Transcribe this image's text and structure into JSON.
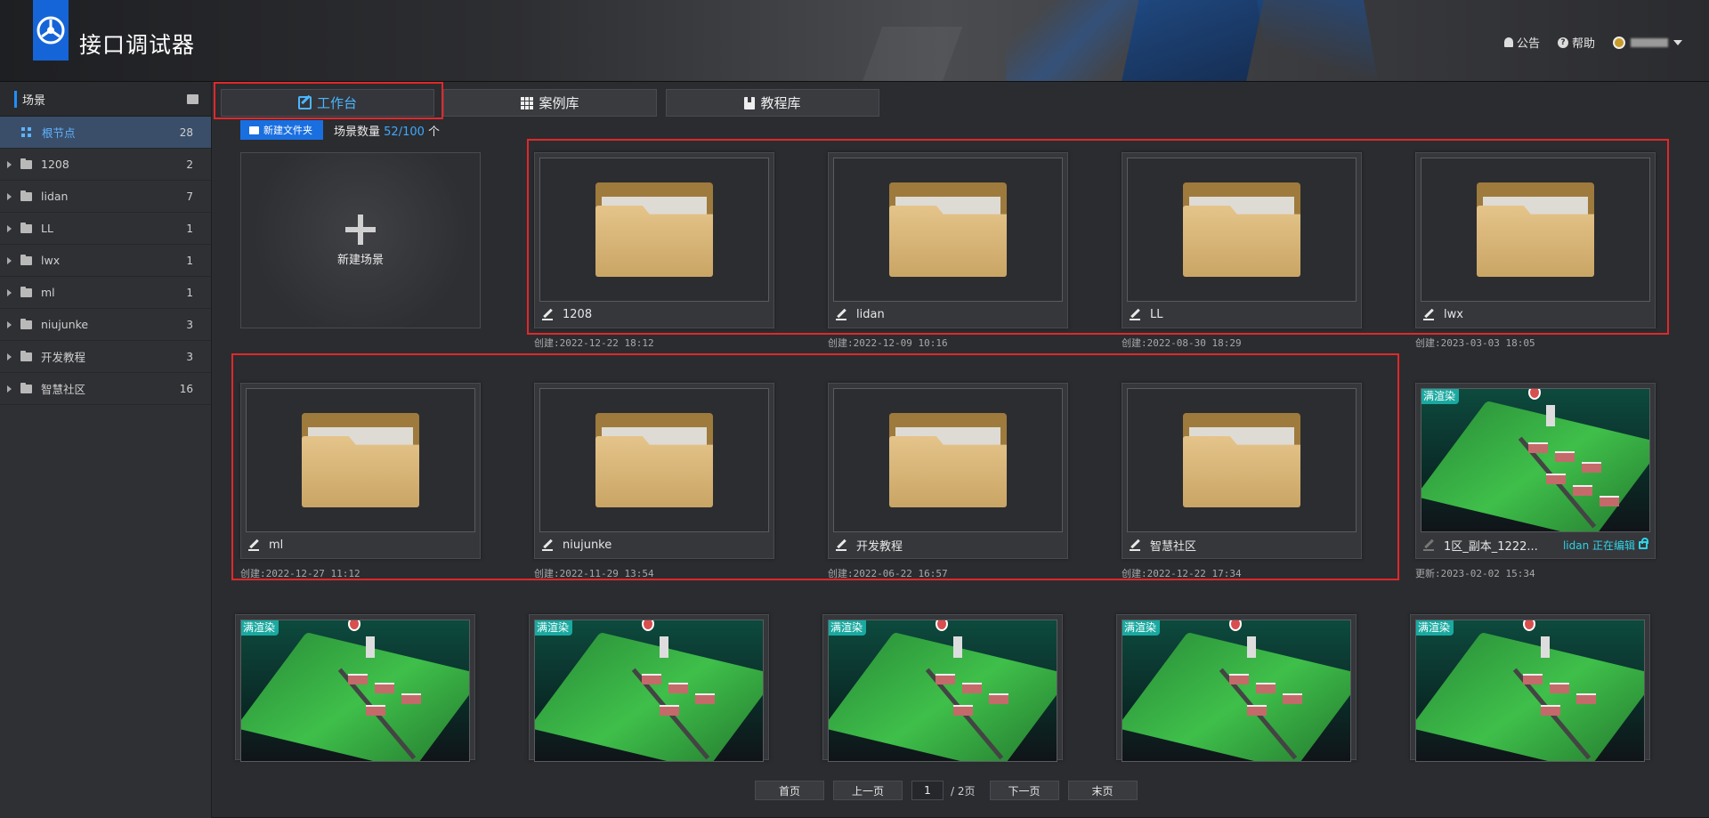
{
  "header": {
    "title": "接口调试器",
    "notice_label": "公告",
    "help_label": "帮助"
  },
  "sidebar": {
    "title": "场景",
    "items": [
      {
        "label": "根节点",
        "count": "28"
      },
      {
        "label": "1208",
        "count": "2"
      },
      {
        "label": "lidan",
        "count": "7"
      },
      {
        "label": "LL",
        "count": "1"
      },
      {
        "label": "lwx",
        "count": "1"
      },
      {
        "label": "ml",
        "count": "1"
      },
      {
        "label": "niujunke",
        "count": "3"
      },
      {
        "label": "开发教程",
        "count": "3"
      },
      {
        "label": "智慧社区",
        "count": "16"
      }
    ]
  },
  "tabs": [
    {
      "label": "工作台",
      "active": true
    },
    {
      "label": "案例库",
      "active": false
    },
    {
      "label": "教程库",
      "active": false
    }
  ],
  "toolbar": {
    "new_folder_label": "新建文件夹",
    "scene_count_label": "场景数量",
    "scene_count_value": "52/100",
    "scene_count_unit": "个"
  },
  "new_scene": {
    "label": "新建场景"
  },
  "folders": [
    {
      "name": "1208",
      "meta": "创建:2022-12-22 18:12"
    },
    {
      "name": "lidan",
      "meta": "创建:2022-12-09 10:16"
    },
    {
      "name": "LL",
      "meta": "创建:2022-08-30 18:29"
    },
    {
      "name": "lwx",
      "meta": "创建:2023-03-03 18:05"
    },
    {
      "name": "ml",
      "meta": "创建:2022-12-27 11:12"
    },
    {
      "name": "niujunke",
      "meta": "创建:2022-11-29 13:54"
    },
    {
      "name": "开发教程",
      "meta": "创建:2022-06-22 16:57"
    },
    {
      "name": "智慧社区",
      "meta": "创建:2022-12-22 17:34"
    }
  ],
  "scenes": [
    {
      "badge": "满渲染",
      "name": "1区_副本_1222...",
      "editing": "lidan 正在编辑",
      "meta": "更新:2023-02-02 15:34"
    },
    {
      "badge": "满渲染"
    },
    {
      "badge": "满渲染"
    },
    {
      "badge": "满渲染"
    },
    {
      "badge": "满渲染"
    },
    {
      "badge": "满渲染"
    }
  ],
  "pagination": {
    "first": "首页",
    "prev": "上一页",
    "current": "1",
    "total": "/ 2页",
    "next": "下一页",
    "last": "末页"
  },
  "colors": {
    "accent": "#1a6fe0",
    "highlight": "#e0282a",
    "editing": "#2fd3e6"
  }
}
